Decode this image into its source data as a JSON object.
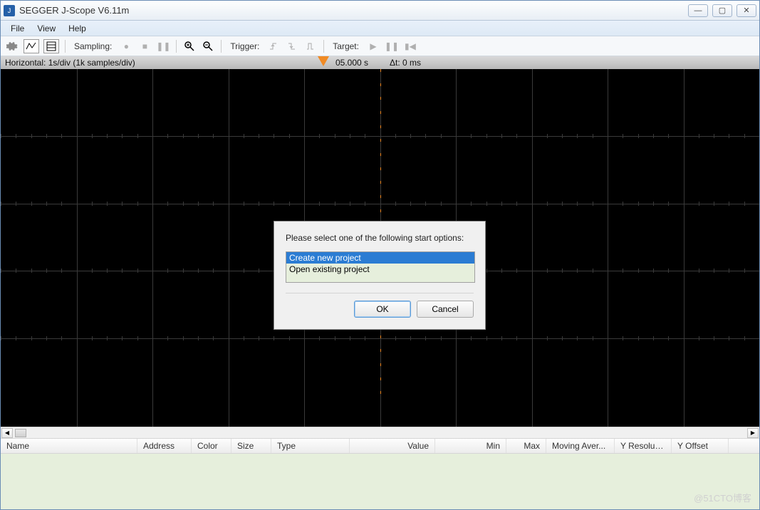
{
  "window": {
    "title": "SEGGER J-Scope V6.11m",
    "minimize": "—",
    "maximize": "▢",
    "close": "✕"
  },
  "menu": {
    "file": "File",
    "view": "View",
    "help": "Help"
  },
  "toolbar": {
    "sampling_label": "Sampling:",
    "trigger_label": "Trigger:",
    "target_label": "Target:"
  },
  "infobar": {
    "horizontal": "Horizontal: 1s/div (1k samples/div)",
    "time": "05.000 s",
    "dt": "Δt: 0 ms"
  },
  "table": {
    "cols": {
      "name": "Name",
      "address": "Address",
      "color": "Color",
      "size": "Size",
      "type": "Type",
      "value": "Value",
      "min": "Min",
      "max": "Max",
      "moving_avg": "Moving Aver...",
      "y_res": "Y Resoluti...",
      "y_off": "Y Offset"
    }
  },
  "dialog": {
    "prompt": "Please select one of the following start options:",
    "option_create": "Create new project",
    "option_open": "Open existing project",
    "ok": "OK",
    "cancel": "Cancel"
  },
  "watermark": "@51CTO博客"
}
